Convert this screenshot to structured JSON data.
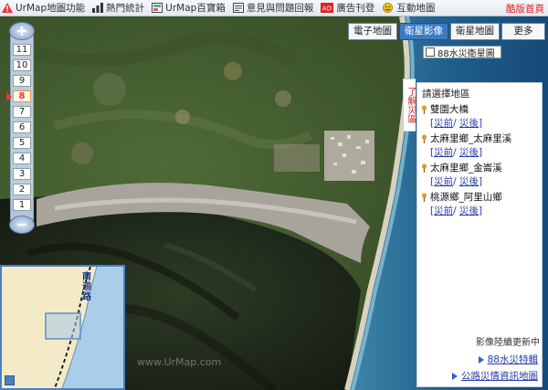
{
  "topbar": {
    "items": [
      {
        "label": "UrMap地圖功能",
        "icon": "warning-triangle-icon"
      },
      {
        "label": "熱門統計",
        "icon": "bar-chart-icon"
      },
      {
        "label": "UrMap百寶箱",
        "icon": "map-book-icon"
      },
      {
        "label": "意見與問題回報",
        "icon": "report-icon"
      },
      {
        "label": "廣告刊登",
        "icon": "ad-icon"
      },
      {
        "label": "互動地圖",
        "icon": "smiley-icon"
      }
    ],
    "home_link": "酷版首頁"
  },
  "zoom": {
    "levels": [
      "11",
      "10",
      "9",
      "8",
      "7",
      "6",
      "5",
      "4",
      "3",
      "2",
      "1"
    ],
    "active_level": "8",
    "zoom_in": "+",
    "zoom_out": "−"
  },
  "maptypes": {
    "buttons": [
      "電子地圖",
      "衛星影像",
      "衛星地圖"
    ],
    "active": "衛星影像",
    "more": "更多",
    "overlay_label": "88水災衛星圖",
    "overlay_checked": false
  },
  "panel": {
    "tab_label": "了解災區",
    "title": "請選擇地區",
    "areas": [
      {
        "name": "雙園大橋",
        "before": "災前",
        "after": "災後"
      },
      {
        "name": "太麻里鄉_太麻里溪",
        "before": "災前",
        "after": "災後"
      },
      {
        "name": "太麻里鄉_金崙溪",
        "before": "災前",
        "after": "災後"
      },
      {
        "name": "桃源鄉_阿里山鄉",
        "before": "災前",
        "after": "災後"
      }
    ],
    "update_note": "影像陸續更新中",
    "links": [
      "88水災特輯",
      "公路災情資訊地圖"
    ]
  },
  "overview": {
    "road_label": "南迴路"
  },
  "watermark": "www.UrMap.com",
  "colors": {
    "accent_red": "#e02020",
    "link_blue": "#2a3ca8",
    "active_blue": "#3c7ac4"
  }
}
